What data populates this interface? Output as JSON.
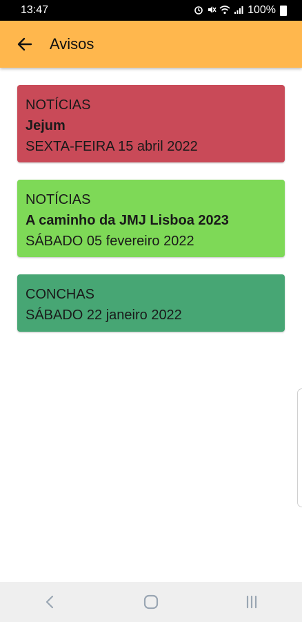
{
  "status_bar": {
    "time": "13:47",
    "battery": "100%",
    "icons": [
      "alarm-icon",
      "mute-icon",
      "wifi-icon",
      "signal-icon",
      "battery-icon"
    ]
  },
  "app_bar": {
    "title": "Avisos",
    "background": "#FFB74D"
  },
  "cards": [
    {
      "category": "NOTÍCIAS",
      "title": "Jejum",
      "date": "SEXTA-FEIRA 15 abril 2022",
      "color": "#C94A58"
    },
    {
      "category": "NOTÍCIAS",
      "title": "A caminho da JMJ Lisboa 2023",
      "date": "SÁBADO 05 fevereiro 2022",
      "color": "#7ED957"
    },
    {
      "category": "CONCHAS",
      "date": "SÁBADO 22 janeiro 2022",
      "color": "#47A674"
    }
  ],
  "nav_bar": {
    "buttons": [
      "back-nav-icon",
      "home-nav-icon",
      "recents-nav-icon"
    ]
  }
}
